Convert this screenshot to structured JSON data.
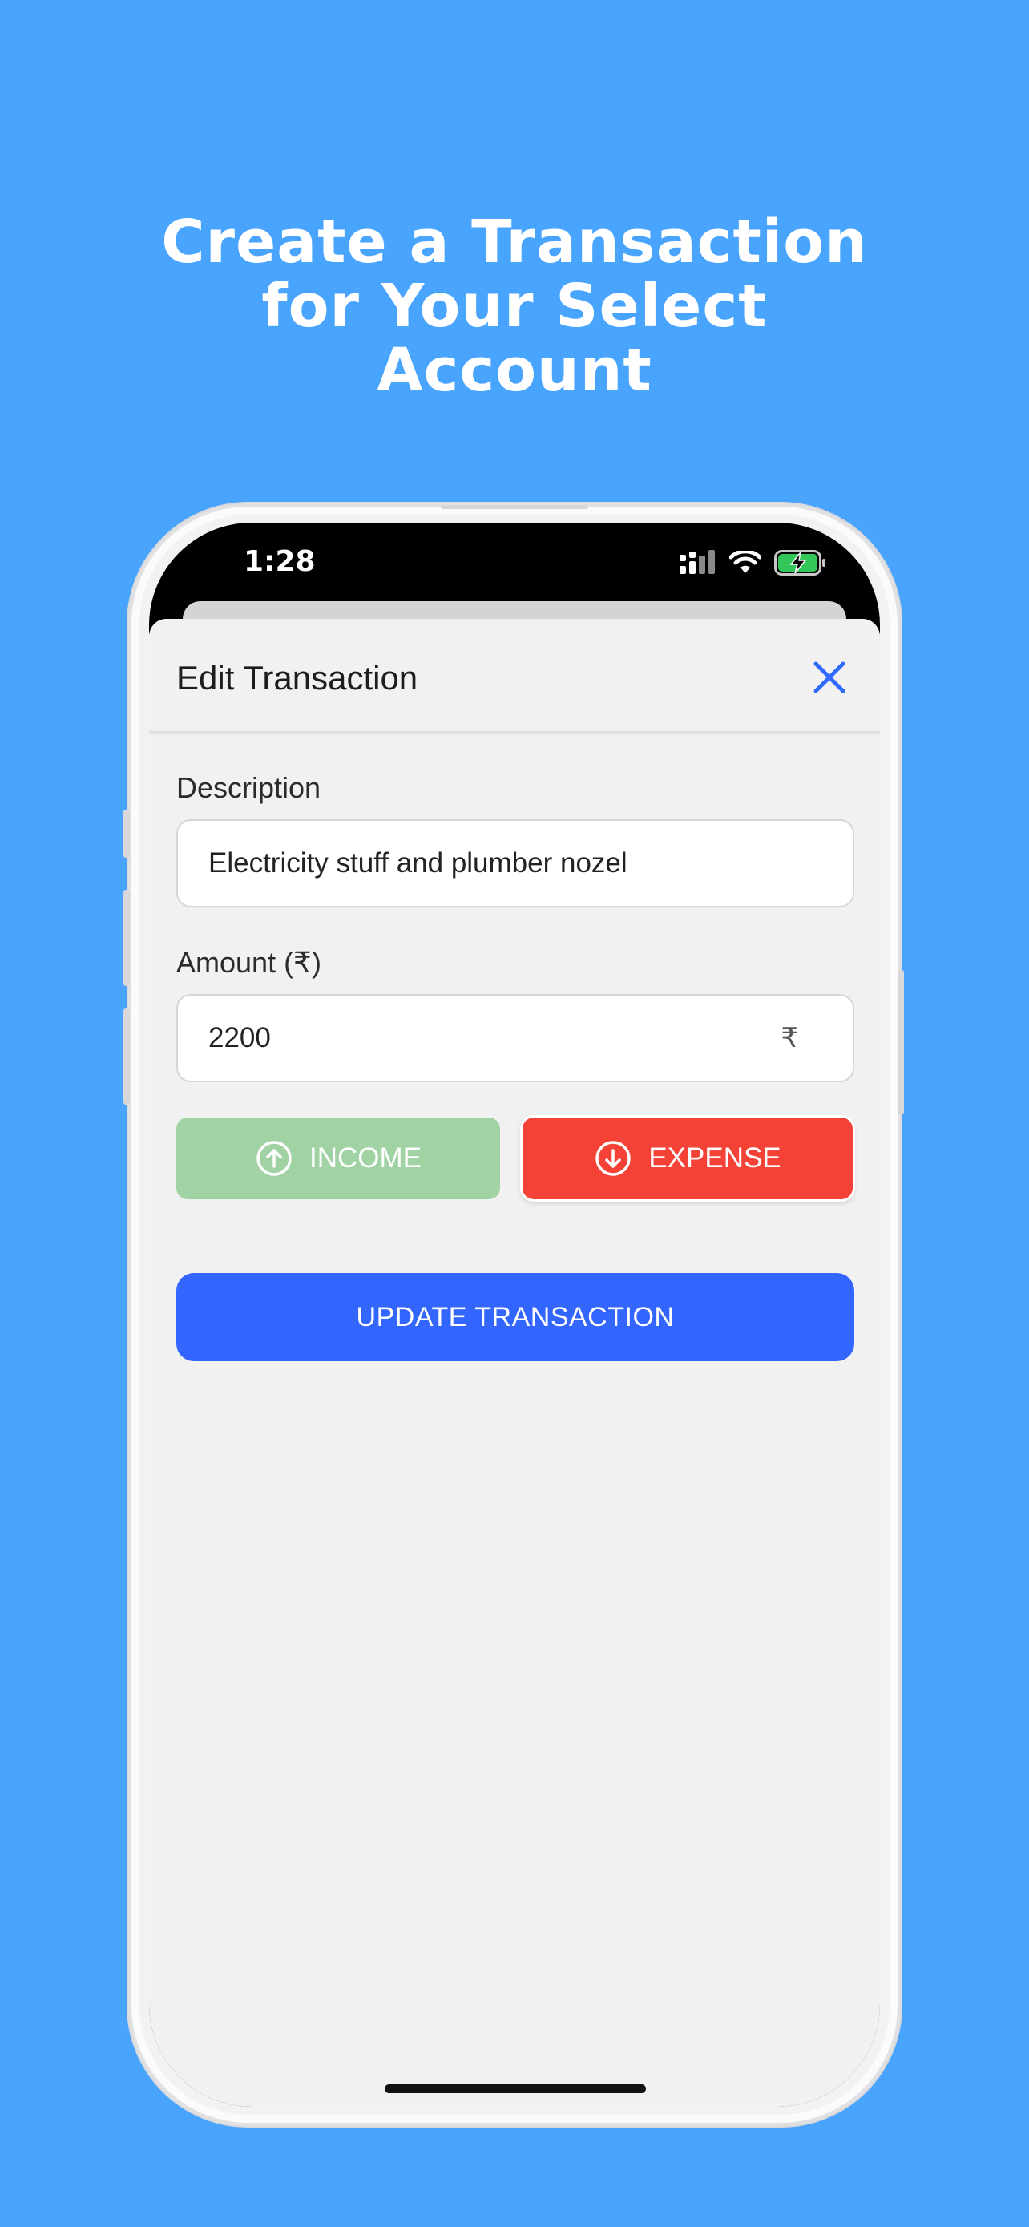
{
  "headline": {
    "line1": "Create a Transaction",
    "line2": "for Your Select",
    "line3": "Account"
  },
  "status_bar": {
    "time": "1:28"
  },
  "sheet": {
    "title": "Edit Transaction",
    "description": {
      "label": "Description",
      "value": "Electricity stuff and plumber nozel"
    },
    "amount": {
      "label": "Amount (₹)",
      "value": "2200",
      "suffix": "₹"
    },
    "type_toggle": {
      "income_label": "INCOME",
      "expense_label": "EXPENSE",
      "selected": "EXPENSE"
    },
    "submit_label": "UPDATE TRANSACTION"
  },
  "colors": {
    "background": "#48a4fd",
    "income": "#a0d2a3",
    "expense": "#f44336",
    "primary": "#3366ff",
    "close_icon": "#2f6bff"
  }
}
